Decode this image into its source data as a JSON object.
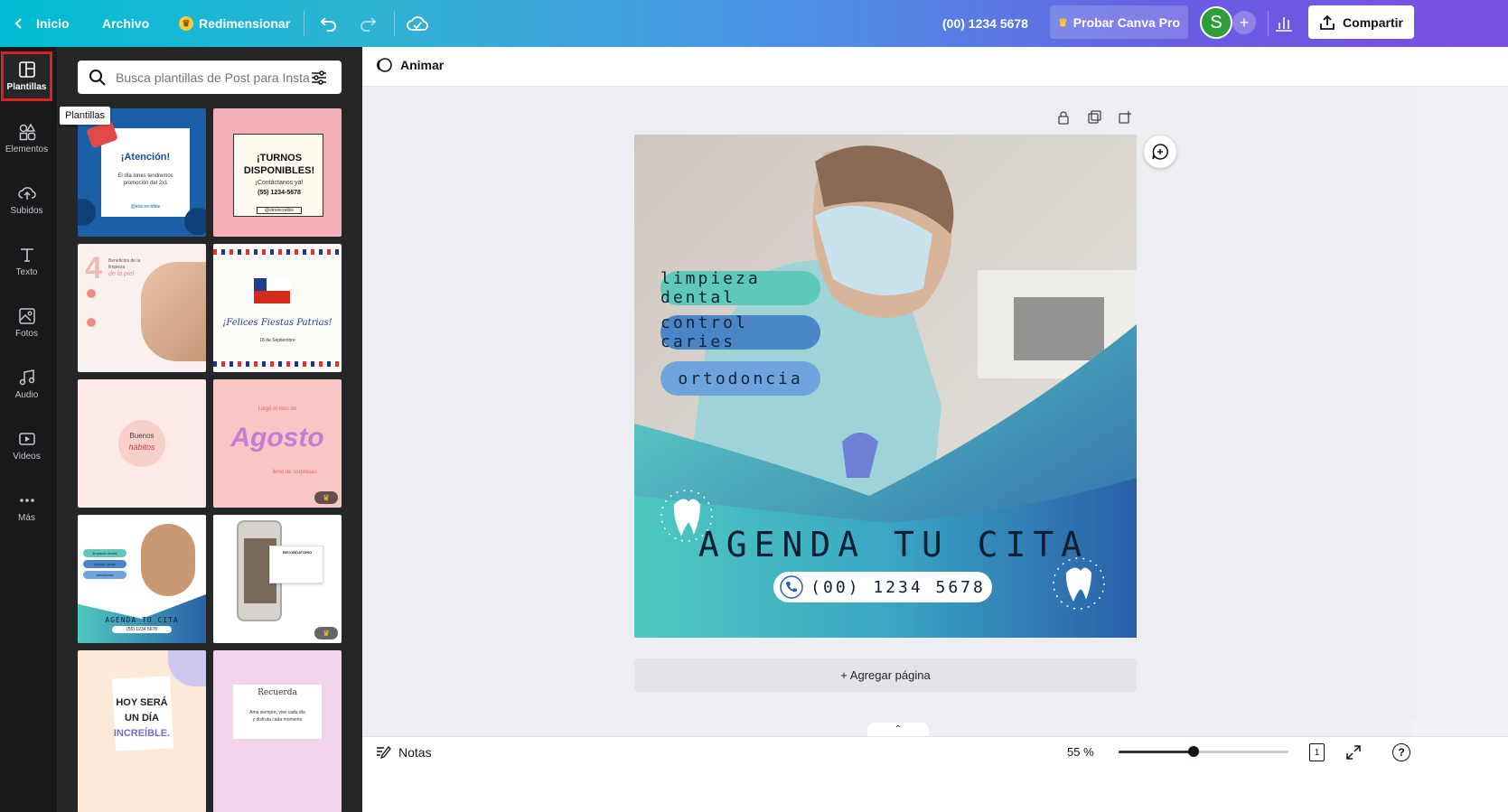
{
  "topbar": {
    "home_label": "Inicio",
    "file_label": "Archivo",
    "resize_label": "Redimensionar",
    "phone": "(00) 1234 5678",
    "pro_label": "Probar Canva Pro",
    "avatar_letter": "S",
    "share_label": "Compartir"
  },
  "rail": {
    "items": [
      {
        "label": "Plantillas",
        "icon": "templates-icon"
      },
      {
        "label": "Elementos",
        "icon": "elements-icon"
      },
      {
        "label": "Subidos",
        "icon": "upload-icon"
      },
      {
        "label": "Texto",
        "icon": "text-icon"
      },
      {
        "label": "Fotos",
        "icon": "photos-icon"
      },
      {
        "label": "Audio",
        "icon": "audio-icon"
      },
      {
        "label": "Videos",
        "icon": "videos-icon"
      },
      {
        "label": "Más",
        "icon": "more-icon"
      }
    ]
  },
  "panel": {
    "search_placeholder": "Busca plantillas de Post para Instagram",
    "tooltip": "Plantillas",
    "templates": [
      {
        "title": "¡Atención!",
        "line1": "El día lunes tendremos",
        "line2": "promoción del 2x1",
        "handle": "@elcicorcidble"
      },
      {
        "title1": "¡TURNOS",
        "title2": "DISPONIBLES!",
        "line1": "¡Contáctanos ya!",
        "phone": "(55) 1234-5678",
        "handle": "@otroincreible"
      },
      {
        "big": "4",
        "l1": "Beneficios de la",
        "l2": "limpieza",
        "l3": "de la piel"
      },
      {
        "title": "¡Felices Fiestas Patrias!",
        "date": "18 de Septiembre"
      },
      {
        "c1": "Buenos",
        "c2": "hábitos"
      },
      {
        "top": "Llegó el mes de",
        "title": "Agosto",
        "bottom": "lleno de sorpresas"
      },
      {
        "bottom": "AGENDA TU CITA",
        "phone": "(55) 1234 5678",
        "pill1": "limpieza dental",
        "pill2": "control caries",
        "pill3": "ortodoncia"
      },
      {
        "title": "RECORDATORIO"
      },
      {
        "l1": "HOY SERÁ",
        "l2": "UN DÍA",
        "l3": "INCREÍBLE."
      },
      {
        "title": "Recuerda",
        "l1": "Ama siempre, vive cada día",
        "l2": "y disfruta cada momento"
      }
    ]
  },
  "editor": {
    "animate_label": "Animar",
    "add_page_label": "+ Agregar página",
    "notes_label": "Notas",
    "zoom": "55 %",
    "zoom_fraction": 0.44,
    "page_count": "1"
  },
  "design": {
    "pills": [
      "limpieza dental",
      "control caries",
      "ortodoncia"
    ],
    "headline": "AGENDA TU CITA",
    "phone": "(00) 1234 5678"
  },
  "colors": {
    "accent_red": "#e02020",
    "teal": "#4fc9c0",
    "blue": "#2a5fa8",
    "pill1": "#5ec9bb",
    "pill2": "#4a86c6",
    "pill3": "#6fa3dd"
  }
}
